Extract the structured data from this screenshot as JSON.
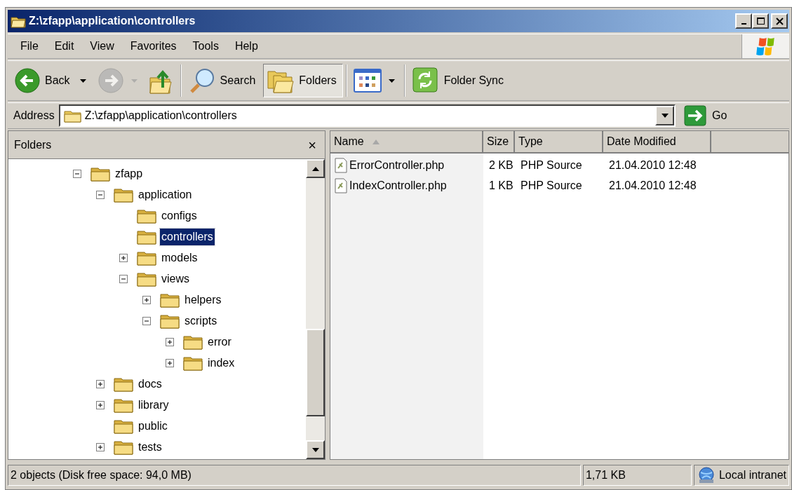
{
  "window": {
    "title": "Z:\\zfapp\\application\\controllers"
  },
  "menu": [
    "File",
    "Edit",
    "View",
    "Favorites",
    "Tools",
    "Help"
  ],
  "toolbar": [
    {
      "kind": "back",
      "label": "Back",
      "disabled": false,
      "pressed": false
    },
    {
      "kind": "forward",
      "disabled": true,
      "pressed": false
    },
    {
      "kind": "up",
      "disabled": false,
      "pressed": false
    },
    {
      "kind": "search",
      "label": "Search",
      "disabled": false,
      "pressed": false
    },
    {
      "kind": "folders",
      "label": "Folders",
      "disabled": false,
      "pressed": true
    },
    {
      "kind": "views",
      "disabled": false,
      "pressed": false
    },
    {
      "kind": "sync",
      "label": "Folder Sync",
      "disabled": false,
      "pressed": false
    }
  ],
  "address": {
    "label": "Address",
    "value": "Z:\\zfapp\\application\\controllers",
    "go": "Go"
  },
  "folders_pane": {
    "title": "Folders",
    "close": "×",
    "tree": [
      {
        "label": "zfapp",
        "kind": "branch",
        "expanded": true,
        "selected": false,
        "children": [
          {
            "label": "application",
            "kind": "branch",
            "expanded": true,
            "selected": false,
            "children": [
              {
                "label": "configs",
                "kind": "leaf",
                "selected": false
              },
              {
                "label": "controllers",
                "kind": "leaf",
                "selected": true
              },
              {
                "label": "models",
                "kind": "branch",
                "expanded": false,
                "selected": false
              },
              {
                "label": "views",
                "kind": "branch",
                "expanded": true,
                "selected": false,
                "children": [
                  {
                    "label": "helpers",
                    "kind": "branch",
                    "expanded": false,
                    "selected": false
                  },
                  {
                    "label": "scripts",
                    "kind": "branch",
                    "expanded": true,
                    "selected": false,
                    "children": [
                      {
                        "label": "error",
                        "kind": "branch",
                        "expanded": false,
                        "selected": false
                      },
                      {
                        "label": "index",
                        "kind": "branch",
                        "expanded": false,
                        "selected": false
                      }
                    ]
                  }
                ]
              }
            ]
          },
          {
            "label": "docs",
            "kind": "branch",
            "expanded": false,
            "selected": false
          },
          {
            "label": "library",
            "kind": "branch",
            "expanded": false,
            "selected": false
          },
          {
            "label": "public",
            "kind": "leaf",
            "selected": false
          },
          {
            "label": "tests",
            "kind": "branch",
            "expanded": false,
            "selected": false
          }
        ]
      }
    ]
  },
  "file_list": {
    "columns": [
      {
        "label": "Name",
        "sorted": true
      },
      {
        "label": "Size",
        "sorted": false
      },
      {
        "label": "Type",
        "sorted": false
      },
      {
        "label": "Date Modified",
        "sorted": false
      }
    ],
    "rows": [
      {
        "cells": [
          "ErrorController.php",
          "2 KB",
          "PHP Source",
          "21.04.2010 12:48"
        ]
      },
      {
        "cells": [
          "IndexController.php",
          "1 KB",
          "PHP Source",
          "21.04.2010 12:48"
        ]
      }
    ]
  },
  "status_bar": {
    "summary": "2 objects (Disk free space: 94,0 MB)",
    "size": "1,71 KB",
    "zone": "Local intranet"
  }
}
